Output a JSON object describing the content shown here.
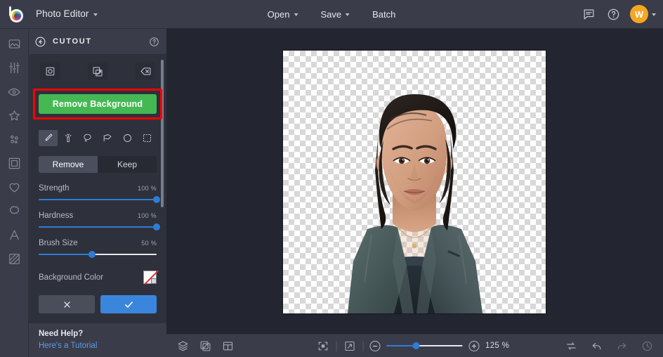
{
  "topbar": {
    "logo_icon": "color-wheel-logo-icon",
    "app_title": "Photo Editor",
    "app_title_caret_icon": "chevron-down-icon",
    "center_buttons": [
      {
        "label": "Open",
        "icon": "chevron-down-icon",
        "has_caret": true
      },
      {
        "label": "Save",
        "icon": "chevron-down-icon",
        "has_caret": true
      },
      {
        "label": "Batch",
        "has_caret": false
      }
    ],
    "feedback_icon": "chat-bubble-icon",
    "help_icon": "question-circle-icon",
    "avatar_initial": "W",
    "avatar_color": "#f5a623",
    "avatar_caret_icon": "chevron-down-icon"
  },
  "rail": {
    "items": [
      {
        "name": "sidebar-item-image",
        "icon": "image-mountain-icon"
      },
      {
        "name": "sidebar-item-adjust",
        "icon": "sliders-icon"
      },
      {
        "name": "sidebar-item-retouch",
        "icon": "eye-icon"
      },
      {
        "name": "sidebar-item-effects",
        "icon": "star-icon"
      },
      {
        "name": "sidebar-item-particles",
        "icon": "particles-icon"
      },
      {
        "name": "sidebar-item-frames",
        "icon": "frame-square-icon"
      },
      {
        "name": "sidebar-item-overlays",
        "icon": "heart-icon"
      },
      {
        "name": "sidebar-item-stickers",
        "icon": "badge-flower-icon"
      },
      {
        "name": "sidebar-item-text",
        "icon": "text-a-icon"
      },
      {
        "name": "sidebar-item-texture",
        "icon": "texture-diagonal-icon"
      }
    ]
  },
  "panel": {
    "back_icon": "arrow-left-circle-icon",
    "title": "CUTOUT",
    "help_icon": "question-circle-icon",
    "modes": [
      {
        "name": "mode-cutout",
        "icon": "circle-in-square-icon"
      },
      {
        "name": "mode-replace-background",
        "icon": "image-swap-icon"
      },
      {
        "name": "mode-clear",
        "icon": "eraser-x-icon"
      }
    ],
    "remove_background_label": "Remove Background",
    "remove_background_color": "#45b854",
    "highlight_color": "#ff0000",
    "brush_tools": [
      {
        "name": "tool-brush",
        "icon": "paintbrush-icon",
        "active": true
      },
      {
        "name": "tool-magic-wand",
        "icon": "magic-wand-icon",
        "active": false
      },
      {
        "name": "tool-lasso",
        "icon": "lasso-icon",
        "active": false
      },
      {
        "name": "tool-polygon-lasso",
        "icon": "polygon-lasso-icon",
        "active": false
      },
      {
        "name": "tool-ellipse-select",
        "icon": "ellipse-icon",
        "active": false
      },
      {
        "name": "tool-rectangle-select",
        "icon": "marquee-rectangle-icon",
        "active": false
      }
    ],
    "segmented": [
      {
        "label": "Remove",
        "active": true
      },
      {
        "label": "Keep",
        "active": false
      }
    ],
    "sliders": [
      {
        "name": "strength",
        "label": "Strength",
        "value": "100 %",
        "percent": 100
      },
      {
        "name": "hardness",
        "label": "Hardness",
        "value": "100 %",
        "percent": 100
      },
      {
        "name": "brush-size",
        "label": "Brush Size",
        "value": "50 %",
        "percent": 50
      }
    ],
    "background_color_label": "Background Color",
    "background_color_swatch": "none-transparent",
    "cancel_icon": "close-x-icon",
    "apply_icon": "check-icon",
    "apply_color": "#3a86dd",
    "footer": {
      "need_help": "Need Help?",
      "tutorial_link": "Here's a Tutorial"
    }
  },
  "canvas": {
    "background": "transparent-checkerboard",
    "subject": "portrait-photo-woman-in-grey-blazer"
  },
  "bottombar": {
    "left_icons": [
      {
        "name": "layers-button",
        "icon": "layers-icon"
      },
      {
        "name": "crop-transform-button",
        "icon": "crop-arrow-icon"
      },
      {
        "name": "layout-grid-button",
        "icon": "layout-panels-icon"
      }
    ],
    "fit_icon": "fit-to-screen-icon",
    "fullscreen_icon": "expand-arrow-icon",
    "zoom_out_icon": "minus-icon",
    "zoom_in_icon": "plus-icon",
    "zoom_value": "125 %",
    "zoom_percent": 125,
    "right_icons": [
      {
        "name": "compare-toggle-button",
        "icon": "swap-arrows-icon",
        "dim": false
      },
      {
        "name": "undo-button",
        "icon": "undo-arrow-icon",
        "dim": false
      },
      {
        "name": "redo-button",
        "icon": "redo-arrow-icon",
        "dim": true
      },
      {
        "name": "history-button",
        "icon": "clock-history-icon",
        "dim": true
      }
    ]
  }
}
